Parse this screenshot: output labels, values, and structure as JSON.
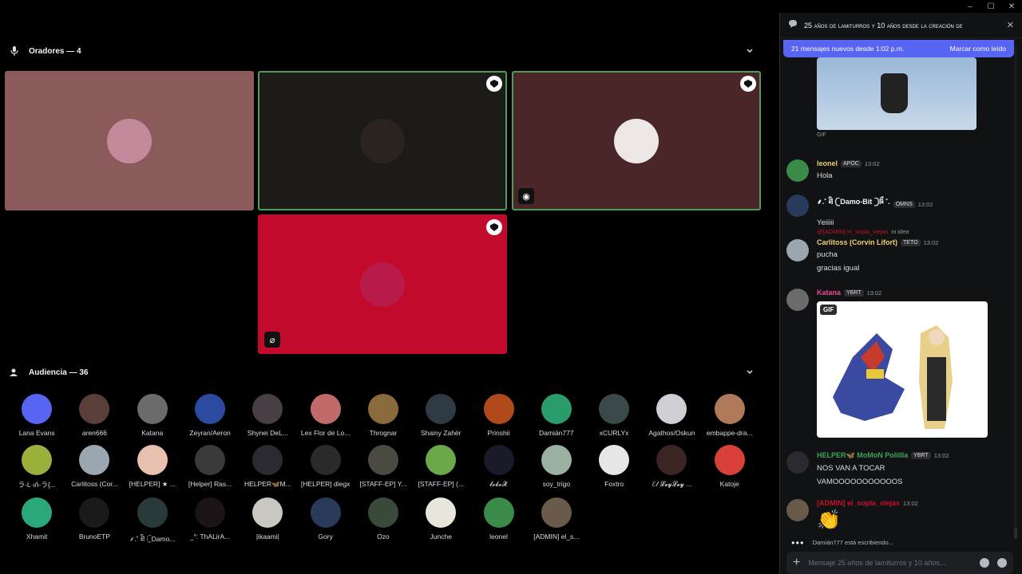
{
  "window_controls": {
    "minimize": "–",
    "maximize": "☐",
    "close": "✕"
  },
  "speakers_section": {
    "title": "Oradores — 4"
  },
  "audience_section": {
    "title": "Audiencia — 36"
  },
  "speakers": [
    {
      "color": "#8b5a5a",
      "avatar": "#c48a9b",
      "speaking": false,
      "moderator": false
    },
    {
      "color": "#1c1b17",
      "avatar": "#2a231f",
      "speaking": true,
      "moderator": true
    },
    {
      "color": "#4a2629",
      "avatar": "#ede8e6",
      "speaking": true,
      "moderator": true
    },
    {
      "color": "#c40a2c",
      "avatar": "#b81a4a",
      "speaking": false,
      "moderator": true
    }
  ],
  "audience": [
    {
      "name": "Lana Evans",
      "color": "#5865f2"
    },
    {
      "name": "aren666",
      "color": "#5a3e3a"
    },
    {
      "name": "Katana",
      "color": "#6b6b6b"
    },
    {
      "name": "Zeyran/Aeron",
      "color": "#2c4aa0"
    },
    {
      "name": "Shynei DeL...",
      "color": "#4a3e46"
    },
    {
      "name": "Lex Flor de Lo...",
      "color": "#c06a6a"
    },
    {
      "name": "Thrognar",
      "color": "#8a6a3a"
    },
    {
      "name": "Shainy Zahér",
      "color": "#2e3a44"
    },
    {
      "name": "Prinshii",
      "color": "#b04a1a"
    },
    {
      "name": "Damián777",
      "color": "#2a9c6a"
    },
    {
      "name": "xCURLYx",
      "color": "#3a4a4a"
    },
    {
      "name": "Agathos/Oskun",
      "color": "#cfcfd6"
    },
    {
      "name": "embappe-dra...",
      "color": "#b07a5a"
    },
    {
      "name": "ラ-L·ıň-ラ{...",
      "color": "#9ab03a"
    },
    {
      "name": "Carlitoss (Cor...",
      "color": "#9aa6b0"
    },
    {
      "name": "[HELPER] ★ ...",
      "color": "#e8c0b0"
    },
    {
      "name": "[Helper] Ras...",
      "color": "#3a3a3a"
    },
    {
      "name": "HELPER🦋M...",
      "color": "#2a2a30"
    },
    {
      "name": "[HELPER] diegx",
      "color": "#2a2a2a"
    },
    {
      "name": "[STAFF-EP] Y...",
      "color": "#4a4a40"
    },
    {
      "name": "[STAFF-EP] (...",
      "color": "#6aa84a"
    },
    {
      "name": "𝓵𝓸𝓫𝓸𝓧",
      "color": "#1a1a2a"
    },
    {
      "name": "soy_trigo",
      "color": "#9ab0a0"
    },
    {
      "name": "Foxtro",
      "color": "#e6e6e6"
    },
    {
      "name": "ℰ𝓁 𝓛𝓮𝔂𝓛𝓮𝔂 ...",
      "color": "#3a2424"
    },
    {
      "name": "Katoje",
      "color": "#d8403a"
    },
    {
      "name": "Xhamit",
      "color": "#2aa87a"
    },
    {
      "name": "BrunoETP",
      "color": "#1a1a1a"
    },
    {
      "name": "⸙.˚ ཐི 𓊆Damo...",
      "color": "#2a3a3a"
    },
    {
      "name": "_°: ThALirA...",
      "color": "#1a1414"
    },
    {
      "name": "|ikaami|",
      "color": "#c8c8c0"
    },
    {
      "name": "Gory",
      "color": "#2a3a5a"
    },
    {
      "name": "Ozo",
      "color": "#3a4a3a"
    },
    {
      "name": "Junche",
      "color": "#e8e6da"
    },
    {
      "name": "leonel",
      "color": "#3a8a4a"
    },
    {
      "name": "[ADMIN] el_s...",
      "color": "#6a5a4a"
    }
  ],
  "chat": {
    "title": "25 años de lamiturros y 10 años desde la creación de",
    "new_messages": "21 mensajes nuevos desde 1:02 p.m.",
    "mark_read": "Marcar como leído",
    "gif_caption": "GIF",
    "messages": [
      {
        "user": "leonel",
        "user_color": "#f0d070",
        "tag": "APOC",
        "time": "13:02",
        "lines": [
          "Hola"
        ],
        "avatar": "#3a8a4a"
      },
      {
        "user": "⸙.˚ ཐི 𓊆Damo-Bit 𓊇ཋྀ ˚.",
        "user_color": "#f2f3f5",
        "tag": "OMNS",
        "time": "13:02",
        "lines": [
          "Yeiiiii"
        ],
        "avatar": "#2a3a5a"
      },
      {
        "user": "Carlitoss (Corvin Lifort)",
        "user_color": "#f0d070",
        "tag": "TETO",
        "time": "13:02",
        "reply_user": "@[ADMIN] el_sopla_viejas",
        "reply_text": "ni idea",
        "lines": [
          "pucha",
          "gracias igual"
        ],
        "avatar": "#9aa6b0"
      },
      {
        "user": "Katana",
        "user_color": "#ec4899",
        "tag": "YBRT",
        "time": "13:02",
        "lines": [],
        "avatar": "#6b6b6b"
      },
      {
        "user": "HELPER🦋 MoMoN Polillla",
        "user_color": "#3ba55c",
        "tag": "YBRT",
        "time": "13:02",
        "lines": [
          "NOS VAN A TOCAR",
          "VAMOOOOOOOOOOOS"
        ],
        "avatar": "#2a2a30"
      },
      {
        "user": "[ADMIN] el_sopla_viejas",
        "user_color": "#c8102e",
        "tag": "",
        "time": "13:02",
        "lines": [
          "👏"
        ],
        "avatar": "#6a5a4a"
      }
    ],
    "typing": "Damián777 está escribiendo...",
    "composer_placeholder": "Mensaje 25 años de lamiturros y 10 años..."
  }
}
